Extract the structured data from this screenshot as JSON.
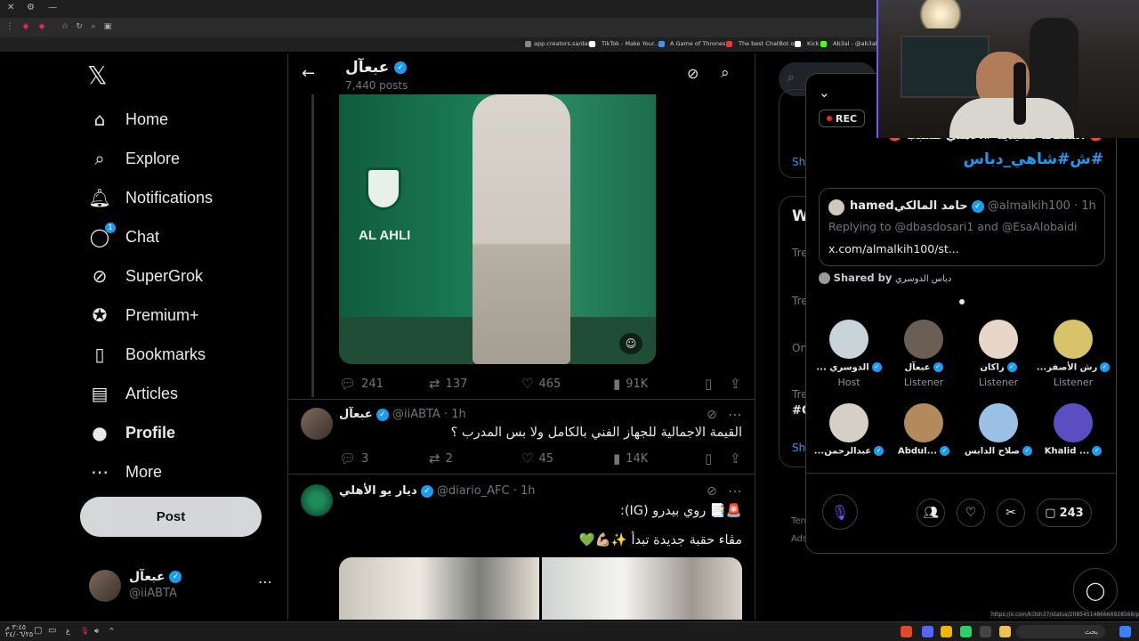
{
  "browser": {
    "bookmarks": [
      {
        "label": "app.creators.sa/das...",
        "color": "#888888"
      },
      {
        "label": "TikTok - Make Your...",
        "color": "#ffffff"
      },
      {
        "label": "A Game of Thrones...",
        "color": "#4a90e2"
      },
      {
        "label": "The best ChatBot on...",
        "color": "#e53935"
      },
      {
        "label": "Kick",
        "color": "#53fc18"
      },
      {
        "label": "Ab3al - @ab3al",
        "color": "#777777"
      }
    ]
  },
  "nav": {
    "items": [
      {
        "label": "Home",
        "icon": "home-icon",
        "glyph": "⌂"
      },
      {
        "label": "Explore",
        "icon": "search-icon",
        "glyph": "⌕"
      },
      {
        "label": "Notifications",
        "icon": "bell-icon",
        "glyph": "🔔︎"
      },
      {
        "label": "Chat",
        "icon": "chat-icon",
        "glyph": "◯",
        "badge": "1"
      },
      {
        "label": "SuperGrok",
        "icon": "grok-icon",
        "glyph": "⊘"
      },
      {
        "label": "Premium+",
        "icon": "premium-icon",
        "glyph": "✪"
      },
      {
        "label": "Bookmarks",
        "icon": "bookmark-icon",
        "glyph": "▯"
      },
      {
        "label": "Articles",
        "icon": "articles-icon",
        "glyph": "▤"
      },
      {
        "label": "Profile",
        "icon": "profile-icon",
        "glyph": "●"
      },
      {
        "label": "More",
        "icon": "more-icon",
        "glyph": "⋯"
      }
    ],
    "post_label": "Post",
    "account": {
      "name": "عبعآل",
      "handle": "@iiABTA"
    }
  },
  "profile_header": {
    "name": "عبعآل",
    "posts": "7,440 posts"
  },
  "tweets": [
    {
      "replies": "241",
      "reposts": "137",
      "likes": "465",
      "views": "91K",
      "image_text": "AL AHLI"
    },
    {
      "name": "عبعآل",
      "handle": "@iiABTA",
      "time": "1h",
      "text": "القيمة الاجمالية للجهاز الفني بالكامل ولا بس المدرب ؟",
      "replies": "3",
      "reposts": "2",
      "likes": "45",
      "views": "14K"
    },
    {
      "name": "ديار يو الأهلي",
      "handle": "@diario_AFC",
      "time": "1h",
      "line1": "🚨📑 روي بيدرو (IG):",
      "line2": "مڤاء حقبة جديدة تبدأ ✨💪🏼💚"
    }
  ],
  "space": {
    "rec_label": "REC",
    "title_line1": "🔴 استقالة تنفيذية #الأهلي مسبب 🔴",
    "title_line2": "#ش#شاهي_دباس",
    "quote": {
      "name": "hamedحامد المالكي",
      "handle": "@almalkih100 · 1h",
      "replying": "Replying to @dbasdosari1 and @EsaAlobaidi",
      "link": "x.com/almalkih100/st..."
    },
    "shared_by_label": "Shared by",
    "shared_by_name": "دباس الدوسري",
    "speakers": [
      {
        "name": "... الدوسري",
        "role": "Host",
        "color": "#c9d3da"
      },
      {
        "name": "عبعآل",
        "role": "Listener",
        "color": "#6b5e54"
      },
      {
        "name": "راكان",
        "role": "Listener",
        "color": "#e8d7c8"
      },
      {
        "name": "...رش الأصفر",
        "role": "Listener",
        "color": "#d7c36a"
      },
      {
        "name": "...عبدالرحمن",
        "role": "",
        "color": "#d6cfc6"
      },
      {
        "name": "Abdul...",
        "role": "",
        "color": "#b28a5b"
      },
      {
        "name": "صلاح الدابس",
        "role": "",
        "color": "#9bc0e6"
      },
      {
        "name": "Khalid ...",
        "role": "",
        "color": "#5a4ec2"
      }
    ],
    "comment_count": "243"
  },
  "right_col": {
    "show_label": "Sh",
    "whats_label": "W",
    "trend_labels": [
      "Tre",
      "Tre",
      "On",
      "Tre"
    ],
    "hash_label": "#C",
    "footer_1": "Terr",
    "footer_2": "Ads"
  },
  "status_url": "https://x.com/ki3sh37/status/2085451486666928568/photo/1",
  "taskbar": {
    "clock_1": "٣:٤٥ م",
    "clock_2": "٢٤/٠٦/٢٥",
    "search_placeholder": "بحث"
  }
}
